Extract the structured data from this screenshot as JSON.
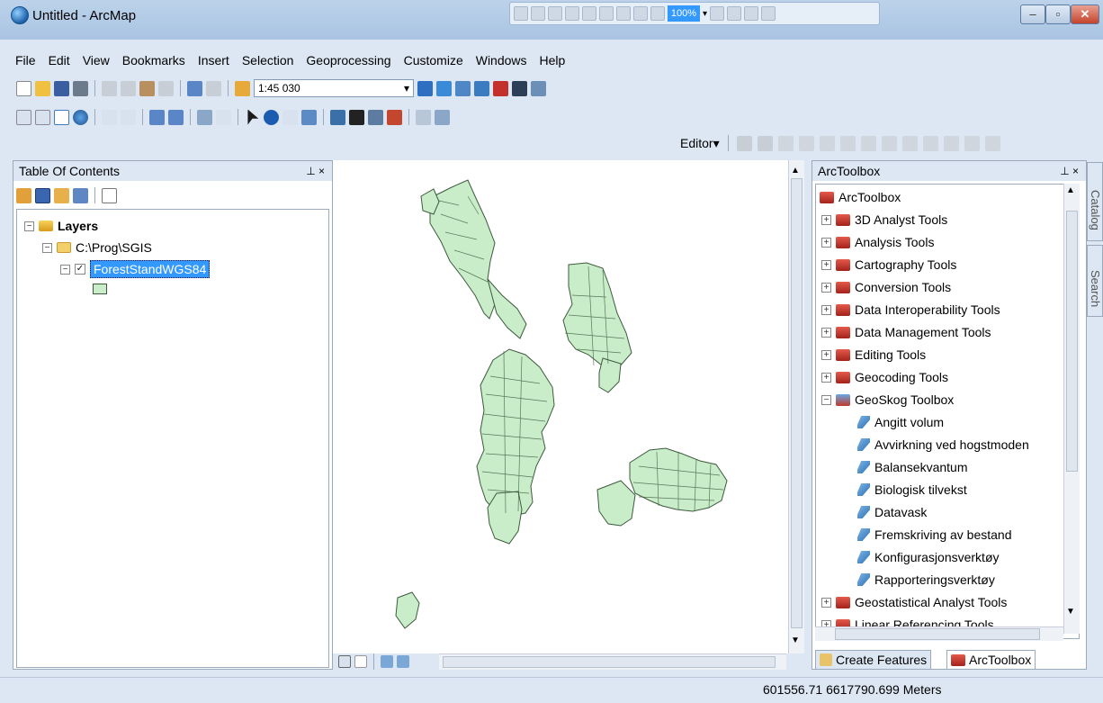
{
  "window": {
    "title": "Untitled - ArcMap",
    "zoom": "100%",
    "minimize": "‒",
    "maximize": "▫",
    "close": "✕"
  },
  "menu": [
    "File",
    "Edit",
    "View",
    "Bookmarks",
    "Insert",
    "Selection",
    "Geoprocessing",
    "Customize",
    "Windows",
    "Help"
  ],
  "toolbar": {
    "scale": "1:45 030"
  },
  "editor": {
    "label": "Editor▾"
  },
  "toc": {
    "title": "Table Of Contents",
    "pin": "⊥ ×",
    "layers_label": "Layers",
    "folder": "C:\\Prog\\SGIS",
    "layer": "ForestStandWGS84",
    "expander_minus": "−",
    "checkbox": "✓"
  },
  "arctoolbox": {
    "title": "ArcToolbox",
    "pin": "⊥ ×",
    "root": "ArcToolbox",
    "toolboxes_before": [
      "3D Analyst Tools",
      "Analysis Tools",
      "Cartography Tools",
      "Conversion Tools",
      "Data Interoperability Tools",
      "Data Management Tools",
      "Editing Tools",
      "Geocoding Tools"
    ],
    "geoskog": "GeoSkog Toolbox",
    "geoskog_tools": [
      "Angitt volum",
      "Avvirkning ved hogstmoden",
      "Balansekvantum",
      "Biologisk tilvekst",
      "Datavask",
      "Fremskriving av bestand",
      "Konfigurasjonsverktøy",
      "Rapporteringsverktøy"
    ],
    "toolboxes_after": [
      "Geostatistical Analyst Tools",
      "Linear Referencing Tools"
    ],
    "expander_plus": "+",
    "expander_minus": "−"
  },
  "tabs": {
    "create_features": "Create Features",
    "arctoolbox": "ArcToolbox"
  },
  "side_tabs": {
    "catalog": "Catalog",
    "search": "Search"
  },
  "status": {
    "coordinates": "601556.71  6617790.699 Meters"
  },
  "colors": {
    "polygon_fill": "#c9ecc9",
    "polygon_stroke": "#3d5a3d",
    "toolbox_red": "#c0392b"
  }
}
